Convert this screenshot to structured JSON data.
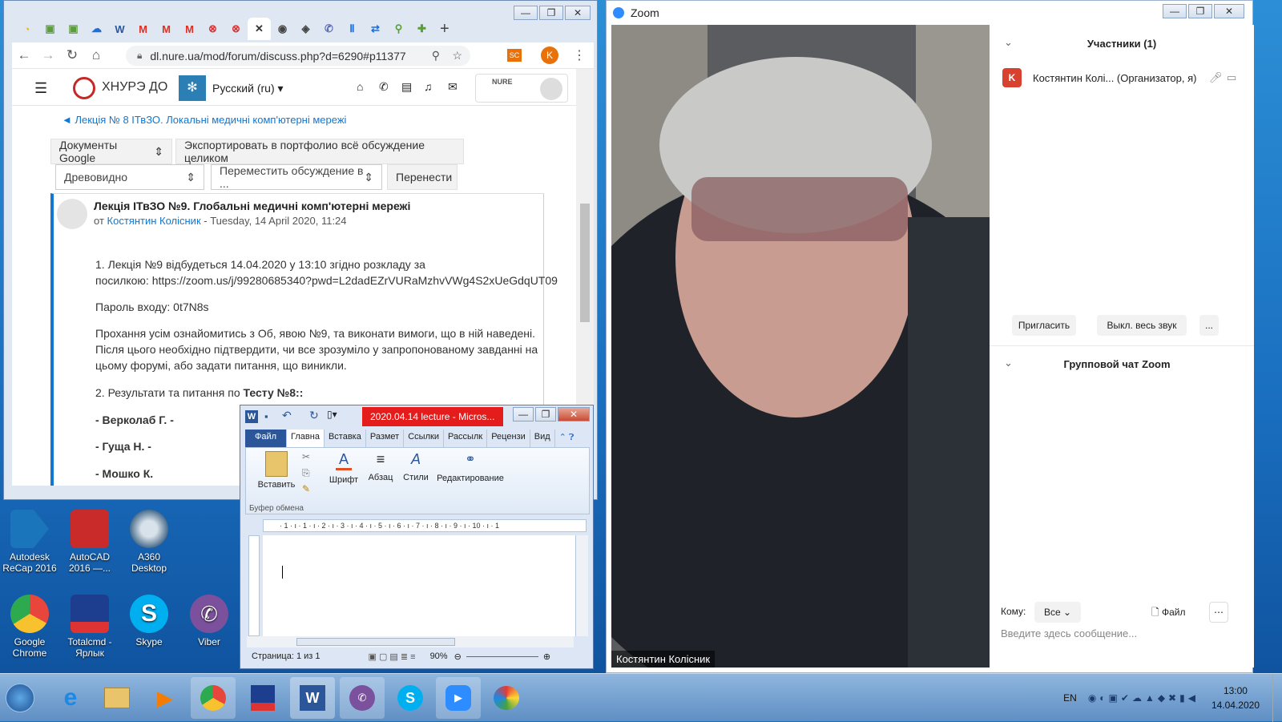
{
  "chrome": {
    "tab_glyphs": [
      "◔",
      "▣",
      "▣",
      "☁",
      "W",
      "M",
      "M",
      "M",
      "⊗",
      "⊗",
      "✕",
      "◉",
      "◈",
      "✆",
      "Ⅱ",
      "⇄",
      "⚲",
      "✚"
    ],
    "new_tab": "+",
    "url": "dl.nure.ua/mod/forum/discuss.php?d=6290#p11377",
    "profile_letter": "K",
    "ext_label": "SC",
    "site": {
      "brand": "ХНУРЭ ДО",
      "language": "Русский (ru)",
      "logo_text": "NURE",
      "breadcrumb": "◄ Лекція № 8 ІТвЗО. Локальні медичні комп'ютерні мережі",
      "btn_google": "Документы Google",
      "btn_export": "Экспортировать в портфолио всё обсуждение целиком",
      "sel_tree": "Древовидно",
      "sel_move": "Переместить обсуждение в ...",
      "btn_move": "Перенести"
    },
    "post": {
      "title": "Лекція ІТвЗО №9. Глобальні медичні комп'ютерні мережі",
      "by_prefix": "от",
      "author": "Костянтин Колісник",
      "date": " - Tuesday, 14 April 2020, 11:24",
      "p1a": "1. Лекція №9 відбудеться  14.04.2020 у 13:10 згідно розкладу за",
      "p1b": "посилкою: https://zoom.us/j/99280685340?pwd=L2dadEZrVURaMzhvVWg4S2xUeGdqUT09",
      "p2": "Пароль входу: 0t7N8s",
      "p3a": "Прохання усім ознайомитись з Об, явою №9, та виконати вимоги, що в ній наведені.",
      "p3b": "Після цього необхідно підтвердити, чи все зрозуміло у запропонованому завданні на",
      "p3c": "цьому форумі, або задати питання, що виникли.",
      "p4": "2. Результати та питання по ",
      "p4b": "Тесту №8::",
      "names": [
        "- Верколаб Г. -",
        "- Гуща Н. -",
        "- Мошко К."
      ]
    }
  },
  "zoom": {
    "title": "Zoom",
    "participants_header": "Участники (1)",
    "participant_initial": "K",
    "participant_name": "Костянтин Колі... (Организатор, я)",
    "invite": "Пригласить",
    "mute_all": "Выкл. весь звук",
    "more": "...",
    "chat_header": "Групповой чат Zoom",
    "to_label": "Кому:",
    "to_value": "Все",
    "file_label": "Файл",
    "placeholder": "Введите здесь сообщение...",
    "video_name": "Костянтин Колісник"
  },
  "word": {
    "title": "2020.04.14 lecture - Micros...",
    "tabs": [
      "Файл",
      "Главна",
      "Вставка",
      "Размет",
      "Ссылки",
      "Рассылк",
      "Рецензи",
      "Вид"
    ],
    "paste": "Вставить",
    "clipboard": "Буфер обмена",
    "font": "Шрифт",
    "paragraph": "Абзац",
    "styles": "Стили",
    "editing": "Редактирование",
    "page_status": "Страница: 1 из 1",
    "zoom_pct": "90%",
    "ruler": "· 1 · ı · 1 · ı · 2 · ı · 3 · ı · 4 · ı · 5 · ı · 6 · ı · 7 · ı · 8 · ı · 9 · ı · 10 · ı · 1"
  },
  "desktop_icons": [
    {
      "label": "Autodesk ReCap 2016",
      "color": "#1b75bb"
    },
    {
      "label": "AutoCAD 2016 —...",
      "color": "#c92b2b"
    },
    {
      "label": "A360 Desktop",
      "color": "#4a6d8c"
    },
    {
      "label": "Google Chrome",
      "color": "#e8453c"
    },
    {
      "label": "Totalcmd - Ярлык",
      "color": "#1d3d8f"
    },
    {
      "label": "Skype",
      "color": "#00aff0"
    },
    {
      "label": "Viber",
      "color": "#7b519d"
    }
  ],
  "tray": {
    "lang": "EN",
    "time": "13:00",
    "date": "14.04.2020"
  }
}
